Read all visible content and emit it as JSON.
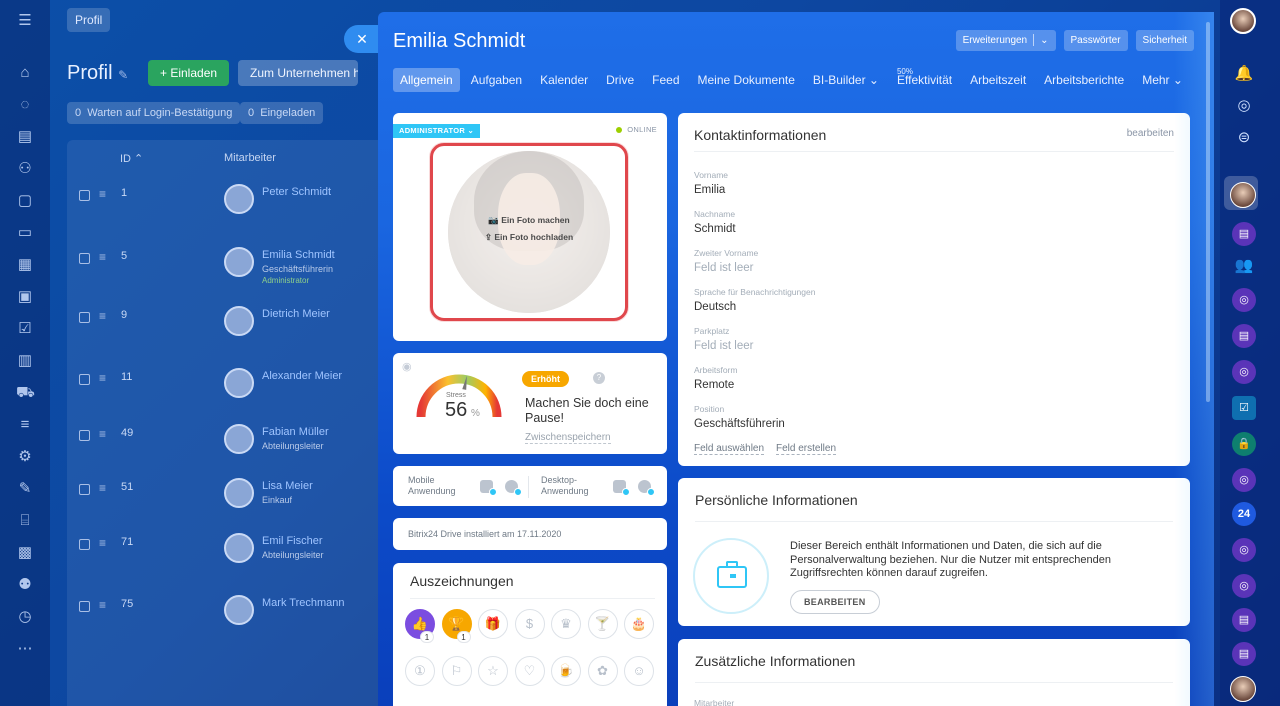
{
  "background": {
    "title_chip": "Profil",
    "heading": "Profil",
    "invite_button": "+ Einladen",
    "company_button": "Zum Unternehmen h",
    "filters": [
      {
        "count": "0",
        "label": "Warten auf Login-Bestätigung"
      },
      {
        "count": "0",
        "label": "Eingeladen"
      }
    ],
    "columns": {
      "id": "ID",
      "employee": "Mitarbeiter"
    },
    "rows": [
      {
        "id": "1",
        "name": "Peter Schmidt",
        "position": "",
        "role": ""
      },
      {
        "id": "5",
        "name": "Emilia Schmidt",
        "position": "Geschäftsführerin",
        "role": "Administrator"
      },
      {
        "id": "9",
        "name": "Dietrich Meier",
        "position": "",
        "role": ""
      },
      {
        "id": "11",
        "name": "Alexander Meier",
        "position": "",
        "role": ""
      },
      {
        "id": "49",
        "name": "Fabian Müller",
        "position": "Abteilungsleiter",
        "role": ""
      },
      {
        "id": "51",
        "name": "Lisa Meier",
        "position": "Einkauf",
        "role": ""
      },
      {
        "id": "71",
        "name": "Emil Fischer",
        "position": "Abteilungsleiter",
        "role": ""
      },
      {
        "id": "75",
        "name": "Mark Trechmann",
        "position": "",
        "role": ""
      }
    ]
  },
  "slider": {
    "close_icon": "close-icon",
    "title": "Emilia Schmidt",
    "header_buttons": {
      "extensions": "Erweiterungen",
      "passwords": "Passwörter",
      "security": "Sicherheit"
    },
    "tabs": [
      {
        "label": "Allgemein",
        "active": true,
        "badge": ""
      },
      {
        "label": "Aufgaben",
        "badge": ""
      },
      {
        "label": "Kalender",
        "badge": ""
      },
      {
        "label": "Drive",
        "badge": ""
      },
      {
        "label": "Feed",
        "badge": ""
      },
      {
        "label": "Meine Dokumente",
        "badge": ""
      },
      {
        "label": "BI-Builder ⌄",
        "badge": ""
      },
      {
        "label": "Effektivität",
        "badge": "50%"
      },
      {
        "label": "Arbeitszeit",
        "badge": ""
      },
      {
        "label": "Arbeitsberichte",
        "badge": ""
      },
      {
        "label": "Mehr ⌄",
        "badge": ""
      }
    ]
  },
  "photo_card": {
    "badge": "ADMINISTRATOR",
    "status": "ONLINE",
    "status_color": "#9dcf00",
    "take_photo": "Ein Foto machen",
    "upload_photo": "Ein Foto hochladen"
  },
  "stress": {
    "label": "Stress",
    "value": "56",
    "unit": "%",
    "level": "Erhöht",
    "message": "Machen Sie doch eine Pause!",
    "save": "Zwischenspeichern",
    "gauge_fraction": 0.56
  },
  "apps": {
    "mobile": "Mobile Anwendung",
    "desktop": "Desktop-Anwendung"
  },
  "drive": {
    "text": "Bitrix24 Drive installiert am 17.11.2020"
  },
  "awards": {
    "title": "Auszeichnungen",
    "items": [
      {
        "icon": "thumbs-up-icon",
        "glyph": "👍",
        "count": "1",
        "active": "on1"
      },
      {
        "icon": "trophy-icon",
        "glyph": "🏆",
        "count": "1",
        "active": "on2"
      },
      {
        "icon": "gift-icon",
        "glyph": "🎁"
      },
      {
        "icon": "money-bag-icon",
        "glyph": "$"
      },
      {
        "icon": "crown-icon",
        "glyph": "♛"
      },
      {
        "icon": "cocktail-icon",
        "glyph": "🍸"
      },
      {
        "icon": "cake-icon",
        "glyph": "🎂"
      },
      {
        "icon": "number-one-icon",
        "glyph": "①"
      },
      {
        "icon": "flag-icon",
        "glyph": "⚐"
      },
      {
        "icon": "star-icon",
        "glyph": "☆"
      },
      {
        "icon": "heart-icon",
        "glyph": "♡"
      },
      {
        "icon": "beer-icon",
        "glyph": "🍺"
      },
      {
        "icon": "flower-icon",
        "glyph": "✿"
      },
      {
        "icon": "smile-icon",
        "glyph": "☺"
      }
    ]
  },
  "contact": {
    "title": "Kontaktinformationen",
    "edit": "bearbeiten",
    "fields": [
      {
        "label": "Vorname",
        "value": "Emilia",
        "empty": false
      },
      {
        "label": "Nachname",
        "value": "Schmidt",
        "empty": false
      },
      {
        "label": "Zweiter Vorname",
        "value": "Feld ist leer",
        "empty": true
      },
      {
        "label": "Sprache für Benachrichtigungen",
        "value": "Deutsch",
        "empty": false
      },
      {
        "label": "Parkplatz",
        "value": "Feld ist leer",
        "empty": true
      },
      {
        "label": "Arbeitsform",
        "value": "Remote",
        "empty": false
      },
      {
        "label": "Position",
        "value": "Geschäftsführerin",
        "empty": false
      }
    ],
    "select_field": "Feld auswählen",
    "create_field": "Feld erstellen"
  },
  "personal": {
    "title": "Persönliche Informationen",
    "description": "Dieser Bereich enthält Informationen und Daten, die sich auf die Personalverwaltung beziehen. Nur die Nutzer mit entsprechenden Zugriffsrechten können darauf zugreifen.",
    "button": "BEARBEITEN"
  },
  "extra": {
    "title": "Zusätzliche Informationen",
    "first_label": "Mitarbeiter"
  },
  "right_sidebar": {
    "counter_label": "24"
  }
}
